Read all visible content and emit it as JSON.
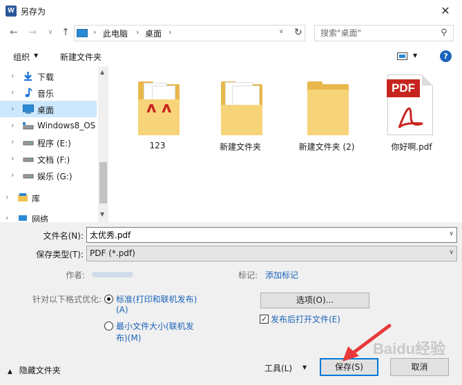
{
  "window": {
    "title": "另存为",
    "close": "✕"
  },
  "nav": {
    "back": "←",
    "forward": "→",
    "recent": "∨",
    "up": "↑",
    "refresh": "↻"
  },
  "address": {
    "sep": "›",
    "crumbs": [
      "此电脑",
      "桌面"
    ],
    "dropdown": "∨"
  },
  "search": {
    "placeholder": "搜索\"桌面\""
  },
  "toolbar": {
    "organize": "组织",
    "new_folder": "新建文件夹",
    "caret": "▼",
    "help": "?"
  },
  "sidebar": {
    "items": [
      {
        "label": "下载",
        "icon": "download-icon"
      },
      {
        "label": "音乐",
        "icon": "music-icon"
      },
      {
        "label": "桌面",
        "icon": "desktop-icon",
        "selected": true
      },
      {
        "label": "Windows8_OS",
        "icon": "drive-icon"
      },
      {
        "label": "程序 (E:)",
        "icon": "drive-icon"
      },
      {
        "label": "文档 (F:)",
        "icon": "drive-icon"
      },
      {
        "label": "娱乐 (G:)",
        "icon": "drive-icon"
      },
      {
        "label": "库",
        "icon": "library-icon"
      },
      {
        "label": "网络",
        "icon": "network-icon"
      }
    ],
    "chevron": "›"
  },
  "files": [
    {
      "name": "123",
      "type": "folder-with-pdf"
    },
    {
      "name": "新建文件夹",
      "type": "folder-with-docs"
    },
    {
      "name": "新建文件夹 (2)",
      "type": "folder"
    },
    {
      "name": "你好啊.pdf",
      "type": "pdf"
    }
  ],
  "pdf_badge": "PDF",
  "form": {
    "filename_label": "文件名(N):",
    "filename_value": "太优秀.pdf",
    "filetype_label": "保存类型(T):",
    "filetype_value": "PDF (*.pdf)",
    "author_label": "作者:",
    "tags_label": "标记:",
    "tags_link": "添加标记",
    "optimize_label": "针对以下格式优化:",
    "radio_standard_1": "标准(打印和联机发布)",
    "radio_standard_2": "(A)",
    "radio_minimum_1": "最小文件大小(联机发",
    "radio_minimum_2": "布)(M)",
    "options_button": "选项(O)...",
    "open_after_publish": "发布后打开文件(E)",
    "check_mark": "✓",
    "hide_folders": "隐藏文件夹",
    "hide_caret": "▲",
    "tools": "工具(L)",
    "save": "保存(S)",
    "cancel": "取消"
  },
  "watermark": "Baidu经验",
  "colors": {
    "accent": "#0078d7",
    "selected_bg": "#cce8ff",
    "link": "#1a63b8",
    "pdf_red": "#c8241f",
    "folder": "#f7d37a",
    "arrow": "#e83a3a"
  }
}
